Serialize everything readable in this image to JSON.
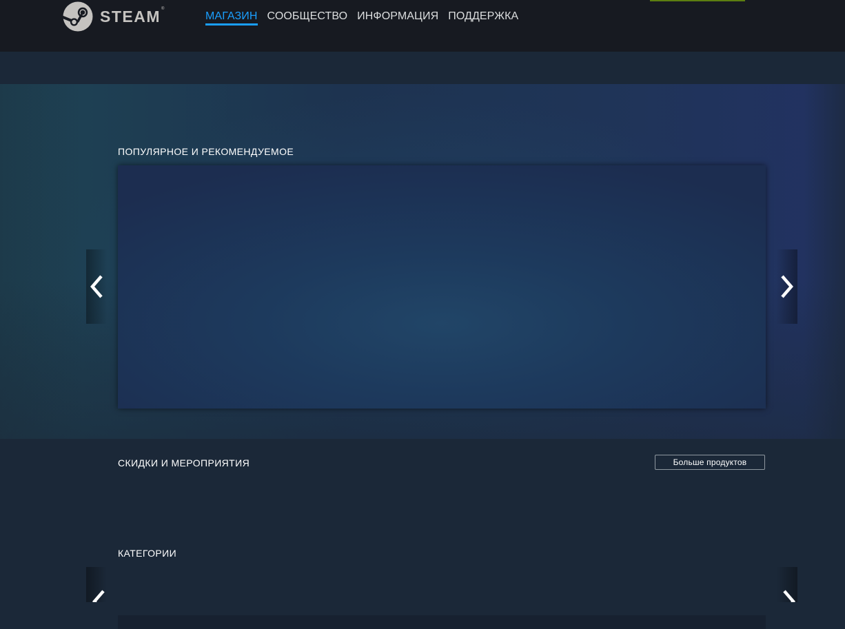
{
  "header": {
    "logo_text": "STEAM",
    "logo_mark": "®",
    "nav": [
      {
        "label": "Магазин",
        "active": true
      },
      {
        "label": "Сообщество",
        "active": false
      },
      {
        "label": "Информация",
        "active": false
      },
      {
        "label": "Поддержка",
        "active": false
      }
    ]
  },
  "featured": {
    "title": "Популярное и рекомендуемое",
    "prev_icon": "chevron-left-icon",
    "next_icon": "chevron-right-icon"
  },
  "specials": {
    "title": "Скидки и мероприятия",
    "more_button": "Больше продуктов"
  },
  "categories": {
    "title": "Категории"
  },
  "colors": {
    "accent": "#1a9fff",
    "header_bg": "#171a21",
    "page_bg": "#1b2838",
    "install_green": "#5c7e10"
  }
}
